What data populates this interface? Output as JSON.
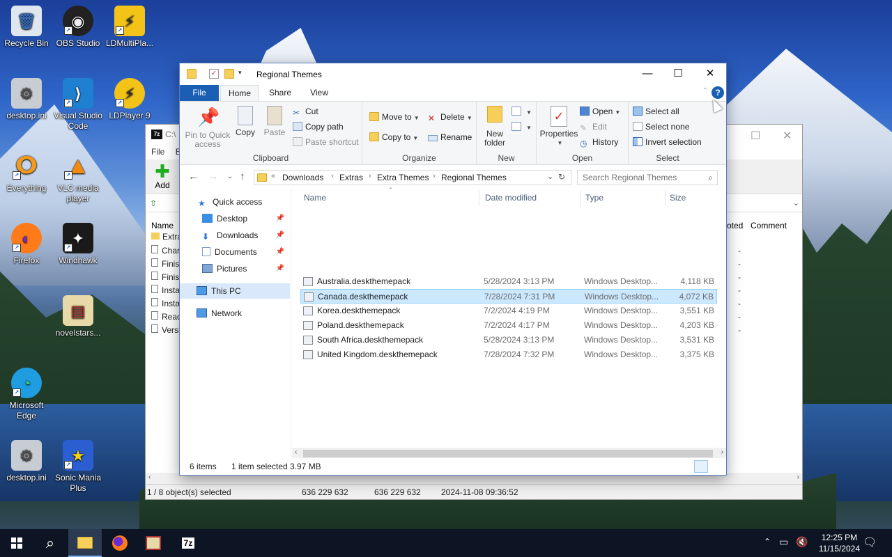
{
  "desktop": {
    "icons": [
      {
        "label": "Recycle Bin",
        "symbol": "🗑"
      },
      {
        "label": "OBS Studio",
        "symbol": "◉"
      },
      {
        "label": "LDMultiPla...",
        "symbol": "⚡"
      },
      {
        "label": "desktop.ini",
        "symbol": "⚙"
      },
      {
        "label": "Visual Studio Code",
        "symbol": "⟩"
      },
      {
        "label": "LDPlayer 9",
        "symbol": "⚡"
      },
      {
        "label": "Everything",
        "symbol": "ⵔ"
      },
      {
        "label": "VLC media player",
        "symbol": "▲"
      },
      {
        "label": "Firefox",
        "symbol": "◐"
      },
      {
        "label": "Windhawk",
        "symbol": "✦"
      },
      {
        "label": "novelstars...",
        "symbol": "▤"
      },
      {
        "label": "Microsoft Edge",
        "symbol": "◔"
      },
      {
        "label": "desktop.ini",
        "symbol": "⚙"
      },
      {
        "label": "Sonic Mania Plus",
        "symbol": "★"
      }
    ]
  },
  "bg_window": {
    "title": "C:\\",
    "logo": "7z",
    "menu": [
      "File",
      "Ec"
    ],
    "add_label": "Add",
    "col_name": "Name",
    "col_comment": "Comment",
    "col_partial": "oted",
    "rows": [
      "Extra",
      "Char",
      "Finis",
      "Finis",
      "Insta",
      "Insta",
      "Read",
      "Versi"
    ],
    "status": {
      "selected": "1 / 8 object(s) selected",
      "size1": "636 229 632",
      "size2": "636 229 632",
      "modified": "2024-11-08 09:36:52"
    }
  },
  "explorer": {
    "title": "Regional Themes",
    "tabs": {
      "file": "File",
      "home": "Home",
      "share": "Share",
      "view": "View"
    },
    "ribbon": {
      "clipboard": {
        "label": "Clipboard",
        "pin": "Pin to Quick access",
        "copy": "Copy",
        "paste": "Paste",
        "cut": "Cut",
        "copy_path": "Copy path",
        "paste_shortcut": "Paste shortcut"
      },
      "organize": {
        "label": "Organize",
        "move_to": "Move to",
        "copy_to": "Copy to",
        "delete": "Delete",
        "rename": "Rename"
      },
      "new": {
        "label": "New",
        "new_folder": "New folder"
      },
      "open": {
        "label": "Open",
        "properties": "Properties",
        "open": "Open",
        "edit": "Edit",
        "history": "History"
      },
      "select": {
        "label": "Select",
        "select_all": "Select all",
        "select_none": "Select none",
        "invert": "Invert selection"
      }
    },
    "breadcrumb": [
      "Downloads",
      "Extras",
      "Extra Themes",
      "Regional Themes"
    ],
    "breadcrumb_overflow": "«",
    "search_placeholder": "Search Regional Themes",
    "nav": {
      "quick_access": "Quick access",
      "desktop": "Desktop",
      "downloads": "Downloads",
      "documents": "Documents",
      "pictures": "Pictures",
      "this_pc": "This PC",
      "network": "Network"
    },
    "columns": {
      "name": "Name",
      "date": "Date modified",
      "type": "Type",
      "size": "Size"
    },
    "files": [
      {
        "name": "Australia.deskthemepack",
        "date": "5/28/2024 3:13 PM",
        "type": "Windows Desktop...",
        "size": "4,118 KB"
      },
      {
        "name": "Canada.deskthemepack",
        "date": "7/28/2024 7:31 PM",
        "type": "Windows Desktop...",
        "size": "4,072 KB"
      },
      {
        "name": "Korea.deskthemepack",
        "date": "7/2/2024 4:19 PM",
        "type": "Windows Desktop...",
        "size": "3,551 KB"
      },
      {
        "name": "Poland.deskthemepack",
        "date": "7/2/2024 4:17 PM",
        "type": "Windows Desktop...",
        "size": "4,203 KB"
      },
      {
        "name": "South Africa.deskthemepack",
        "date": "5/28/2024 3:13 PM",
        "type": "Windows Desktop...",
        "size": "3,531 KB"
      },
      {
        "name": "United Kingdom.deskthemepack",
        "date": "7/28/2024 7:32 PM",
        "type": "Windows Desktop...",
        "size": "3,375 KB"
      }
    ],
    "selected_index": 1,
    "status": {
      "items": "6 items",
      "selected": "1 item selected",
      "size": "3.97 MB"
    }
  },
  "taskbar": {
    "time": "12:25 PM",
    "date": "11/15/2024",
    "apps": [
      "start",
      "search",
      "file-explorer",
      "firefox",
      "novelstars",
      "7zip"
    ],
    "seven_zip_label": "7z"
  },
  "colors": {
    "accent": "#1a5fb4",
    "selection": "#cce8ff",
    "taskbar": "#0d1524"
  }
}
